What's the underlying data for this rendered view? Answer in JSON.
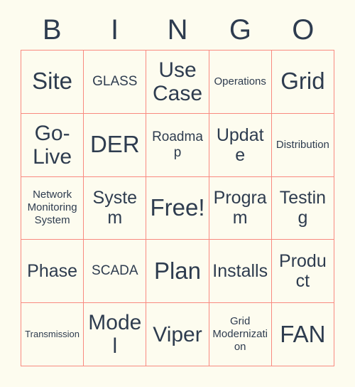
{
  "card": {
    "title": "BINGO",
    "background_color": "#fdfcef",
    "grid_line_color": "#f98a80",
    "text_color": "#2e3c4f"
  },
  "header": {
    "letters": [
      {
        "label": "B"
      },
      {
        "label": "I"
      },
      {
        "label": "N"
      },
      {
        "label": "G"
      },
      {
        "label": "O"
      }
    ]
  },
  "grid": {
    "rows": [
      {
        "cells": [
          {
            "label": "Site",
            "size": "fs-xl",
            "free": false
          },
          {
            "label": "GLASS",
            "size": "fs-sm",
            "free": false
          },
          {
            "label": "Use Case",
            "size": "fs-lg",
            "free": false
          },
          {
            "label": "Operations",
            "size": "fs-xs",
            "free": false
          },
          {
            "label": "Grid",
            "size": "fs-xl",
            "free": false
          }
        ]
      },
      {
        "cells": [
          {
            "label": "Go-Live",
            "size": "fs-lg",
            "free": false
          },
          {
            "label": "DER",
            "size": "fs-xl",
            "free": false
          },
          {
            "label": "Roadmap",
            "size": "fs-sm",
            "free": false
          },
          {
            "label": "Update",
            "size": "fs-md",
            "free": false
          },
          {
            "label": "Distribution",
            "size": "fs-xs",
            "free": false
          }
        ]
      },
      {
        "cells": [
          {
            "label": "Network Monitoring System",
            "size": "fs-xs",
            "free": false
          },
          {
            "label": "System",
            "size": "fs-md",
            "free": false
          },
          {
            "label": "Free!",
            "size": "fs-xl",
            "free": true
          },
          {
            "label": "Program",
            "size": "fs-md",
            "free": false
          },
          {
            "label": "Testing",
            "size": "fs-md",
            "free": false
          }
        ]
      },
      {
        "cells": [
          {
            "label": "Phase",
            "size": "fs-md",
            "free": false
          },
          {
            "label": "SCADA",
            "size": "fs-sm",
            "free": false
          },
          {
            "label": "Plan",
            "size": "fs-xl",
            "free": false
          },
          {
            "label": "Installs",
            "size": "fs-md",
            "free": false
          },
          {
            "label": "Product",
            "size": "fs-md",
            "free": false
          }
        ]
      },
      {
        "cells": [
          {
            "label": "Transmission",
            "size": "fs-xxs",
            "free": false
          },
          {
            "label": "Model",
            "size": "fs-lg",
            "free": false
          },
          {
            "label": "Viper",
            "size": "fs-lg",
            "free": false
          },
          {
            "label": "Grid Modernization",
            "size": "fs-xs",
            "free": false
          },
          {
            "label": "FAN",
            "size": "fs-xl",
            "free": false
          }
        ]
      }
    ]
  }
}
